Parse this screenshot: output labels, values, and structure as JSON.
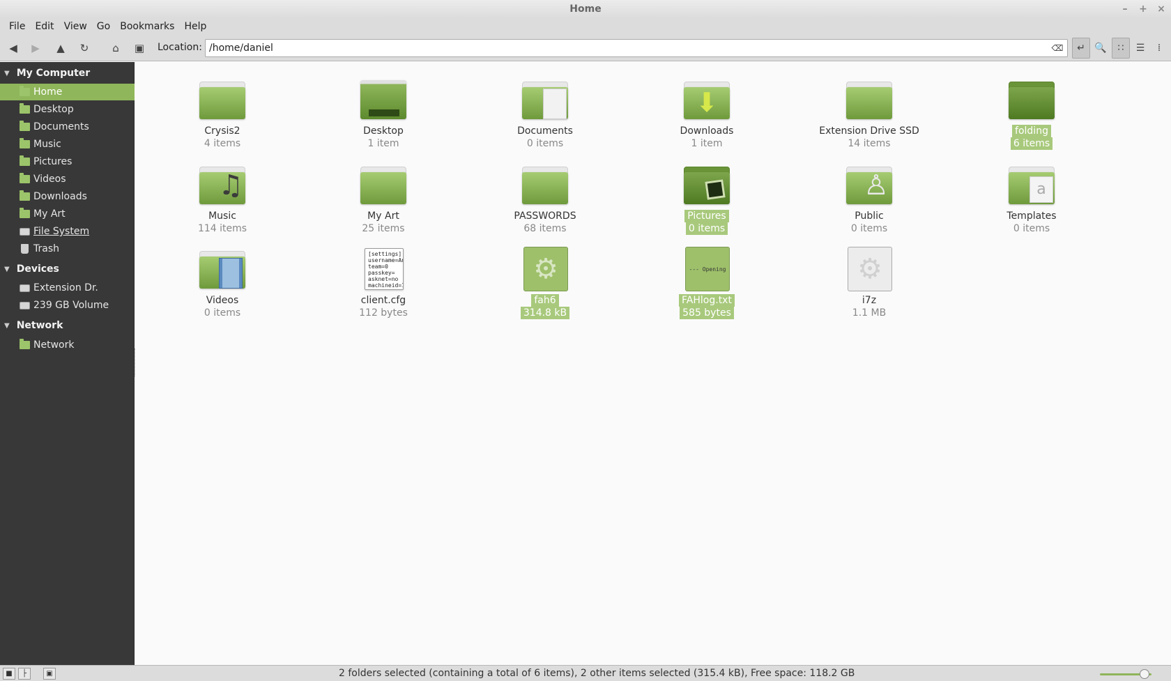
{
  "window": {
    "title": "Home",
    "controls": [
      "–",
      "+",
      "×"
    ]
  },
  "menu": [
    "File",
    "Edit",
    "View",
    "Go",
    "Bookmarks",
    "Help"
  ],
  "toolbar": {
    "location_label": "Location:",
    "location_value": "/home/daniel"
  },
  "sidebar": {
    "sections": [
      {
        "title": "My Computer",
        "items": [
          {
            "label": "Home",
            "icon": "home-folder-icon",
            "selected": true
          },
          {
            "label": "Desktop",
            "icon": "desktop-icon"
          },
          {
            "label": "Documents",
            "icon": "folder-icon"
          },
          {
            "label": "Music",
            "icon": "folder-icon"
          },
          {
            "label": "Pictures",
            "icon": "folder-icon"
          },
          {
            "label": "Videos",
            "icon": "folder-icon"
          },
          {
            "label": "Downloads",
            "icon": "folder-icon"
          },
          {
            "label": "My Art",
            "icon": "folder-icon"
          },
          {
            "label": "File System",
            "icon": "drive-icon"
          },
          {
            "label": "Trash",
            "icon": "trash-icon"
          }
        ]
      },
      {
        "title": "Devices",
        "items": [
          {
            "label": "Extension Dr.",
            "icon": "drive-icon"
          },
          {
            "label": "239 GB Volume",
            "icon": "drive-icon"
          }
        ]
      },
      {
        "title": "Network",
        "items": [
          {
            "label": "Network",
            "icon": "network-icon"
          }
        ]
      }
    ]
  },
  "files": [
    {
      "name": "Crysis2",
      "size": "4 items",
      "kind": "folder"
    },
    {
      "name": "Desktop",
      "size": "1 item",
      "kind": "folder",
      "emblem": "desktop"
    },
    {
      "name": "Documents",
      "size": "0 items",
      "kind": "folder",
      "emblem": "document"
    },
    {
      "name": "Downloads",
      "size": "1 item",
      "kind": "folder",
      "emblem": "download-arrow"
    },
    {
      "name": "Extension Drive SSD",
      "size": "14 items",
      "kind": "folder"
    },
    {
      "name": "folding",
      "size": "6 items",
      "kind": "folder",
      "selected": true
    },
    {
      "name": "Music",
      "size": "114 items",
      "kind": "folder",
      "emblem": "music-note"
    },
    {
      "name": "My Art",
      "size": "25 items",
      "kind": "folder"
    },
    {
      "name": "PASSWORDS",
      "size": "68 items",
      "kind": "folder"
    },
    {
      "name": "Pictures",
      "size": "0 items",
      "kind": "folder",
      "emblem": "picture",
      "selected": true
    },
    {
      "name": "Public",
      "size": "0 items",
      "kind": "folder",
      "emblem": "person"
    },
    {
      "name": "Templates",
      "size": "0 items",
      "kind": "folder",
      "emblem": "template"
    },
    {
      "name": "Videos",
      "size": "0 items",
      "kind": "folder",
      "emblem": "film"
    },
    {
      "name": "client.cfg",
      "size": "112 bytes",
      "kind": "text-file",
      "preview": "[settings]\nusername=An\nteam=0\npasskey=\nasknet=no\nmachineid=1"
    },
    {
      "name": "fah6",
      "size": "314.8 kB",
      "kind": "executable",
      "selected": true
    },
    {
      "name": "FAHlog.txt",
      "size": "585 bytes",
      "kind": "text-file",
      "preview": "--- Opening",
      "selected": true
    },
    {
      "name": "i7z",
      "size": "1.1 MB",
      "kind": "executable"
    }
  ],
  "status": {
    "text": "2 folders selected (containing a total of 6 items), 2 other items selected (315.4 kB), Free space: 118.2 GB",
    "zoom_level": 0.77
  },
  "colors": {
    "accent": "#8fb65a",
    "sidebar_bg": "#383838",
    "selection": "#a8c97c"
  }
}
